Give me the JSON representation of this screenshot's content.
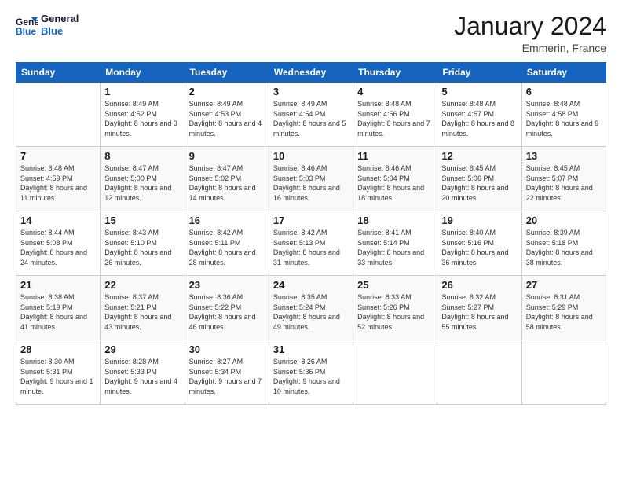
{
  "logo": {
    "line1": "General",
    "line2": "Blue"
  },
  "title": "January 2024",
  "location": "Emmerin, France",
  "days_header": [
    "Sunday",
    "Monday",
    "Tuesday",
    "Wednesday",
    "Thursday",
    "Friday",
    "Saturday"
  ],
  "weeks": [
    [
      {
        "day": "",
        "sunrise": "",
        "sunset": "",
        "daylight": ""
      },
      {
        "day": "1",
        "sunrise": "Sunrise: 8:49 AM",
        "sunset": "Sunset: 4:52 PM",
        "daylight": "Daylight: 8 hours and 3 minutes."
      },
      {
        "day": "2",
        "sunrise": "Sunrise: 8:49 AM",
        "sunset": "Sunset: 4:53 PM",
        "daylight": "Daylight: 8 hours and 4 minutes."
      },
      {
        "day": "3",
        "sunrise": "Sunrise: 8:49 AM",
        "sunset": "Sunset: 4:54 PM",
        "daylight": "Daylight: 8 hours and 5 minutes."
      },
      {
        "day": "4",
        "sunrise": "Sunrise: 8:48 AM",
        "sunset": "Sunset: 4:56 PM",
        "daylight": "Daylight: 8 hours and 7 minutes."
      },
      {
        "day": "5",
        "sunrise": "Sunrise: 8:48 AM",
        "sunset": "Sunset: 4:57 PM",
        "daylight": "Daylight: 8 hours and 8 minutes."
      },
      {
        "day": "6",
        "sunrise": "Sunrise: 8:48 AM",
        "sunset": "Sunset: 4:58 PM",
        "daylight": "Daylight: 8 hours and 9 minutes."
      }
    ],
    [
      {
        "day": "7",
        "sunrise": "Sunrise: 8:48 AM",
        "sunset": "Sunset: 4:59 PM",
        "daylight": "Daylight: 8 hours and 11 minutes."
      },
      {
        "day": "8",
        "sunrise": "Sunrise: 8:47 AM",
        "sunset": "Sunset: 5:00 PM",
        "daylight": "Daylight: 8 hours and 12 minutes."
      },
      {
        "day": "9",
        "sunrise": "Sunrise: 8:47 AM",
        "sunset": "Sunset: 5:02 PM",
        "daylight": "Daylight: 8 hours and 14 minutes."
      },
      {
        "day": "10",
        "sunrise": "Sunrise: 8:46 AM",
        "sunset": "Sunset: 5:03 PM",
        "daylight": "Daylight: 8 hours and 16 minutes."
      },
      {
        "day": "11",
        "sunrise": "Sunrise: 8:46 AM",
        "sunset": "Sunset: 5:04 PM",
        "daylight": "Daylight: 8 hours and 18 minutes."
      },
      {
        "day": "12",
        "sunrise": "Sunrise: 8:45 AM",
        "sunset": "Sunset: 5:06 PM",
        "daylight": "Daylight: 8 hours and 20 minutes."
      },
      {
        "day": "13",
        "sunrise": "Sunrise: 8:45 AM",
        "sunset": "Sunset: 5:07 PM",
        "daylight": "Daylight: 8 hours and 22 minutes."
      }
    ],
    [
      {
        "day": "14",
        "sunrise": "Sunrise: 8:44 AM",
        "sunset": "Sunset: 5:08 PM",
        "daylight": "Daylight: 8 hours and 24 minutes."
      },
      {
        "day": "15",
        "sunrise": "Sunrise: 8:43 AM",
        "sunset": "Sunset: 5:10 PM",
        "daylight": "Daylight: 8 hours and 26 minutes."
      },
      {
        "day": "16",
        "sunrise": "Sunrise: 8:42 AM",
        "sunset": "Sunset: 5:11 PM",
        "daylight": "Daylight: 8 hours and 28 minutes."
      },
      {
        "day": "17",
        "sunrise": "Sunrise: 8:42 AM",
        "sunset": "Sunset: 5:13 PM",
        "daylight": "Daylight: 8 hours and 31 minutes."
      },
      {
        "day": "18",
        "sunrise": "Sunrise: 8:41 AM",
        "sunset": "Sunset: 5:14 PM",
        "daylight": "Daylight: 8 hours and 33 minutes."
      },
      {
        "day": "19",
        "sunrise": "Sunrise: 8:40 AM",
        "sunset": "Sunset: 5:16 PM",
        "daylight": "Daylight: 8 hours and 36 minutes."
      },
      {
        "day": "20",
        "sunrise": "Sunrise: 8:39 AM",
        "sunset": "Sunset: 5:18 PM",
        "daylight": "Daylight: 8 hours and 38 minutes."
      }
    ],
    [
      {
        "day": "21",
        "sunrise": "Sunrise: 8:38 AM",
        "sunset": "Sunset: 5:19 PM",
        "daylight": "Daylight: 8 hours and 41 minutes."
      },
      {
        "day": "22",
        "sunrise": "Sunrise: 8:37 AM",
        "sunset": "Sunset: 5:21 PM",
        "daylight": "Daylight: 8 hours and 43 minutes."
      },
      {
        "day": "23",
        "sunrise": "Sunrise: 8:36 AM",
        "sunset": "Sunset: 5:22 PM",
        "daylight": "Daylight: 8 hours and 46 minutes."
      },
      {
        "day": "24",
        "sunrise": "Sunrise: 8:35 AM",
        "sunset": "Sunset: 5:24 PM",
        "daylight": "Daylight: 8 hours and 49 minutes."
      },
      {
        "day": "25",
        "sunrise": "Sunrise: 8:33 AM",
        "sunset": "Sunset: 5:26 PM",
        "daylight": "Daylight: 8 hours and 52 minutes."
      },
      {
        "day": "26",
        "sunrise": "Sunrise: 8:32 AM",
        "sunset": "Sunset: 5:27 PM",
        "daylight": "Daylight: 8 hours and 55 minutes."
      },
      {
        "day": "27",
        "sunrise": "Sunrise: 8:31 AM",
        "sunset": "Sunset: 5:29 PM",
        "daylight": "Daylight: 8 hours and 58 minutes."
      }
    ],
    [
      {
        "day": "28",
        "sunrise": "Sunrise: 8:30 AM",
        "sunset": "Sunset: 5:31 PM",
        "daylight": "Daylight: 9 hours and 1 minute."
      },
      {
        "day": "29",
        "sunrise": "Sunrise: 8:28 AM",
        "sunset": "Sunset: 5:33 PM",
        "daylight": "Daylight: 9 hours and 4 minutes."
      },
      {
        "day": "30",
        "sunrise": "Sunrise: 8:27 AM",
        "sunset": "Sunset: 5:34 PM",
        "daylight": "Daylight: 9 hours and 7 minutes."
      },
      {
        "day": "31",
        "sunrise": "Sunrise: 8:26 AM",
        "sunset": "Sunset: 5:36 PM",
        "daylight": "Daylight: 9 hours and 10 minutes."
      },
      {
        "day": "",
        "sunrise": "",
        "sunset": "",
        "daylight": ""
      },
      {
        "day": "",
        "sunrise": "",
        "sunset": "",
        "daylight": ""
      },
      {
        "day": "",
        "sunrise": "",
        "sunset": "",
        "daylight": ""
      }
    ]
  ]
}
